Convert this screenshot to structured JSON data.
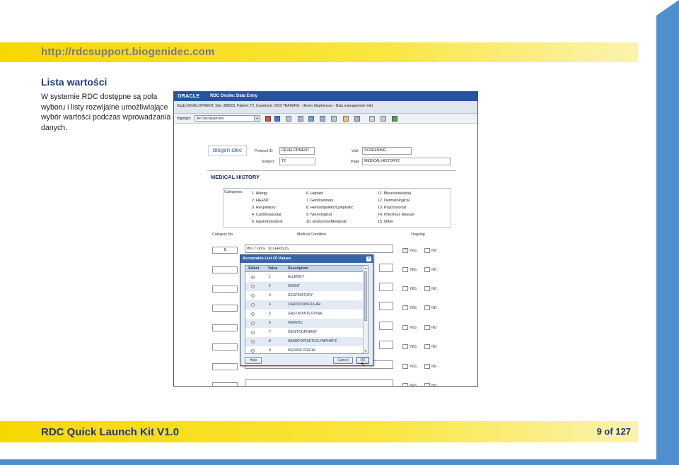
{
  "slide": {
    "url": "http://rdcsupport.biogenidec.com",
    "section_title": "Lista wartości",
    "body_text": "W systemie RDC dostępne są pola wyboru i listy rozwijalne umożliwiające wybór wartości podczas wprowadzania danych.",
    "footer_title": "RDC Quick Launch Kit V1.0",
    "page_number": "9 of 127",
    "colors": {
      "accent_blue": "#4f8fcf",
      "band_yellow": "#f6d800",
      "title_blue": "#1f3a78"
    }
  },
  "screenshot": {
    "app_brand": "ORACLE",
    "window_title": "RDC Onsite: Data Entry",
    "study_line": "Study:DEVELOPMENT, Site: 388203, Patient: T2, Casebook: 2010 TRAINING - (Kevin Stephenson - Data management role)",
    "highlight_label": "Highlight",
    "highlight_value": "All Discrepancies",
    "form": {
      "logo_text": "biogen idec",
      "protocol_label": "Protocol ID",
      "protocol_value": "DEVELOPMENT",
      "subject_label": "Subject",
      "subject_value": "T2",
      "visit_label": "Visit",
      "visit_value": "SCREENING",
      "page_label": "Page",
      "page_value": "MEDICAL HISTORY2",
      "section_heading": "MEDICAL HISTORY",
      "categories_label": "Categories:",
      "categories": [
        "1. Allergy",
        "2. HEENT",
        "3. Respiratory",
        "4. Cardiovascular",
        "5. Gastrointestinal",
        "6. Hepatic",
        "7. Genitourinary",
        "8. Hematopoietic/Lymphatic",
        "9. Neurological",
        "10. Endocrine/Metabolic",
        "11. Musculoskeletal",
        "12. Dermatological",
        "13. Psychosocial",
        "14. Infectious disease",
        "15. Other"
      ],
      "col_category": "Category No.",
      "col_condition": "Medical Condition",
      "col_ongoing": "Ongoing",
      "row1_category": "9",
      "row1_condition": "MULTIPLE SCLEROSIS",
      "yes_label": "YES",
      "no_label": "NO"
    },
    "popup": {
      "title": "Acceptable List Of Values",
      "close": "x",
      "col_select": "Select",
      "col_value": "Value",
      "col_description": "Description",
      "rows": [
        {
          "value": "1",
          "description": "ALLERGY"
        },
        {
          "value": "2",
          "description": "HEENT"
        },
        {
          "value": "3",
          "description": "RESPIRATORY"
        },
        {
          "value": "4",
          "description": "CARDIOVASCULAR"
        },
        {
          "value": "5",
          "description": "GASTROINTESTINAL"
        },
        {
          "value": "6",
          "description": "HEPATIC"
        },
        {
          "value": "7",
          "description": "GENITOURINARY"
        },
        {
          "value": "8",
          "description": "HEMATOPOIETIC/LYMPHATIC"
        },
        {
          "value": "9",
          "description": "NEUROLOGICAL"
        }
      ],
      "help_button": "Help",
      "cancel_button": "Cancel",
      "ok_button": "OK"
    }
  }
}
